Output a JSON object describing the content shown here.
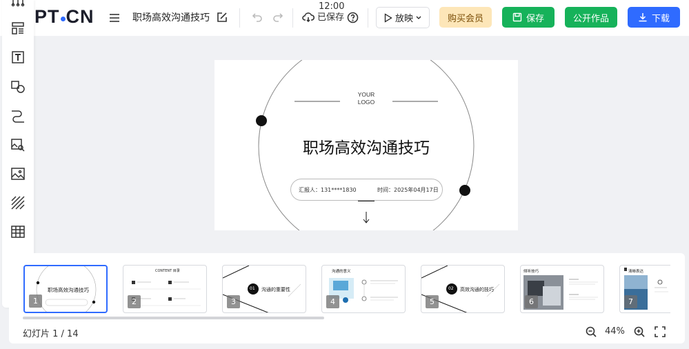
{
  "app": {
    "logo": "PT.CN"
  },
  "header": {
    "doc_title": "职场高效沟通技巧",
    "save_time": "12:00",
    "save_status": "已保存",
    "play_label": "放映",
    "buy_label": "购买会员",
    "save_label": "保存",
    "publish_label": "公开作品",
    "download_label": "下载"
  },
  "toolbar": {
    "tools": [
      "layout-icon",
      "text-icon",
      "shape-icon",
      "line-icon",
      "image-search-icon",
      "image-icon",
      "pattern-icon",
      "table-icon",
      "chart-icon",
      "formula-icon"
    ]
  },
  "slide": {
    "logo_line1": "YOUR",
    "logo_line2": "LOGO",
    "title": "职场高效沟通技巧",
    "reporter": "汇报人：131****1830",
    "time": "时间：2025年04月17日"
  },
  "thumbnails": [
    {
      "num": "1",
      "title": "职场高效沟通技巧"
    },
    {
      "num": "2",
      "title": "CONTENT 目录"
    },
    {
      "num": "3",
      "title": "沟通的重要性",
      "badge": "01"
    },
    {
      "num": "4",
      "title": "沟通的意义"
    },
    {
      "num": "5",
      "title": "高效沟通的技巧",
      "badge": "02"
    },
    {
      "num": "6",
      "title": "倾听技巧"
    },
    {
      "num": "7",
      "title": "清晰表达"
    }
  ],
  "footer": {
    "slide_count": "幻灯片 1 / 14",
    "zoom": "44%"
  },
  "colors": {
    "accent": "#2f6bff",
    "save_green": "#16b25a",
    "buy_bg": "#fde6b8"
  }
}
